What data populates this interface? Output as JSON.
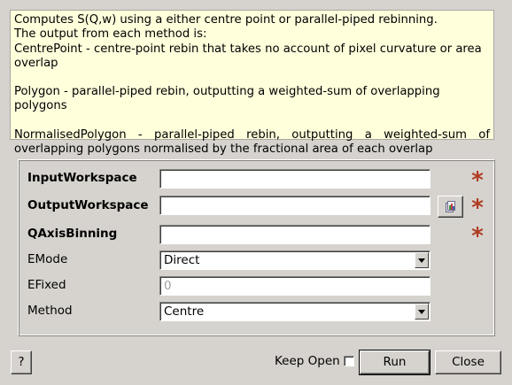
{
  "description": {
    "line1": "Computes S(Q,w) using a either centre point or parallel-piped rebinning.",
    "line2": "The output from each method is:",
    "line3": "CentrePoint - centre-point rebin that takes no account of pixel curvature or area overlap",
    "line4": "Polygon - parallel-piped rebin, outputting a weighted-sum of overlapping polygons",
    "line5": "NormalisedPolygon - parallel-piped rebin, outputting a weighted-sum of overlapping polygons normalised by the fractional area of each overlap"
  },
  "properties": [
    {
      "label": "InputWorkspace",
      "value": "",
      "required": true
    },
    {
      "label": "OutputWorkspace",
      "value": "",
      "required": true
    },
    {
      "label": "QAxisBinning",
      "value": "",
      "required": true
    },
    {
      "label": "EMode",
      "value": "Direct"
    },
    {
      "label": "EFixed",
      "value": "",
      "placeholder": "0"
    },
    {
      "label": "Method",
      "value": "Centre"
    }
  ],
  "required_marker": "*",
  "icons": {
    "browse": "folder-icon",
    "combo_arrow": "chevron-down-icon"
  },
  "footer": {
    "help_label": "?",
    "keep_open_label": "Keep Open",
    "keep_open_checked": false,
    "run_label": "Run",
    "close_label": "Close"
  },
  "colors": {
    "background": "#d6d3ce",
    "description_bg": "#ffffdc",
    "required_star": "#b03a22"
  }
}
